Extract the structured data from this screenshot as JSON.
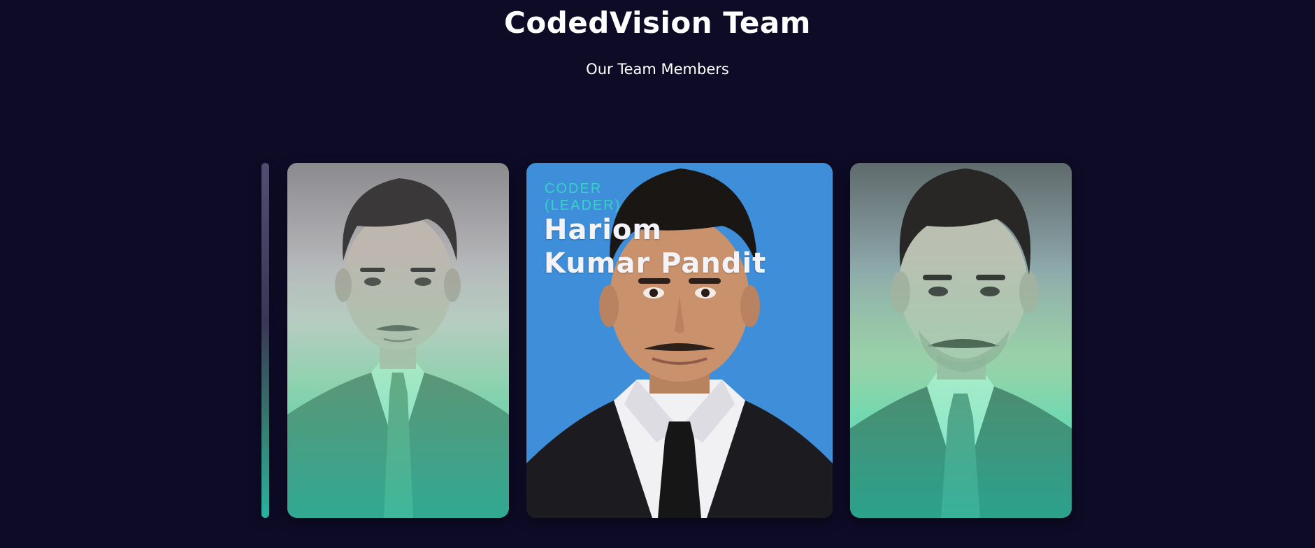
{
  "header": {
    "title": "CodedVision Team",
    "subtitle": "Our Team Members"
  },
  "team": {
    "featured": {
      "role": "CODER (LEADER)",
      "name": "Hariom Kumar Pandit"
    }
  },
  "colors": {
    "background": "#0e0b27",
    "accent": "#35d3c3",
    "card_center_bg": "#3f8ed9"
  },
  "icons": {
    "portrait_left": "person-portrait",
    "portrait_center": "person-portrait",
    "portrait_right": "person-portrait"
  }
}
